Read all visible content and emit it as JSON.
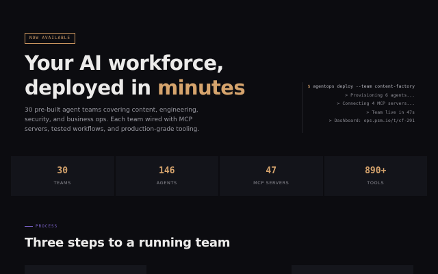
{
  "hero": {
    "badge": "NOW AVAILABLE",
    "title_line1": "Your AI workforce,",
    "title_line2_prefix": "deployed in ",
    "title_line2_accent": "minutes",
    "description": "30 pre-built agent teams covering content, engineering, security, and business ops. Each team wired with MCP servers, tested workflows, and production-grade tooling."
  },
  "terminal": {
    "prompt": "$",
    "command": "agentops deploy --team content-factory",
    "lines": [
      "> Provisioning 6 agents...",
      "> Connecting 4 MCP servers...",
      "> Team live in 47s",
      "> Dashboard: ops.psm.io/t/cf-291"
    ]
  },
  "stats": [
    {
      "value": "30",
      "label": "TEAMS"
    },
    {
      "value": "146",
      "label": "AGENTS"
    },
    {
      "value": "47",
      "label": "MCP SERVERS"
    },
    {
      "value": "890+",
      "label": "TOOLS"
    }
  ],
  "process": {
    "eyebrow": "PROCESS",
    "title": "Three steps to a running team"
  },
  "colors": {
    "background": "#0c0c10",
    "accent": "#d6a46d",
    "eyebrow": "#7a62c8"
  }
}
